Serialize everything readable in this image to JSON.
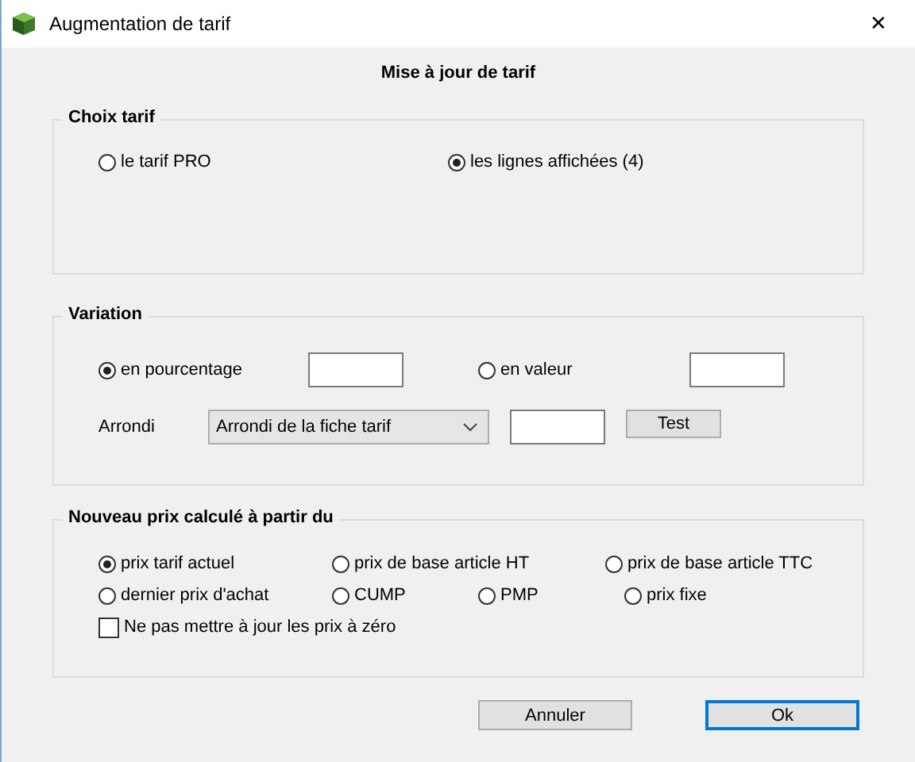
{
  "window": {
    "title": "Augmentation de tarif",
    "close": "✕"
  },
  "heading": "Mise à jour de tarif",
  "choix_tarif": {
    "title": "Choix tarif",
    "options": [
      {
        "label": "le tarif PRO",
        "selected": false
      },
      {
        "label": "les lignes affichées (4)",
        "selected": true
      }
    ]
  },
  "variation": {
    "title": "Variation",
    "options": [
      {
        "label": "en pourcentage",
        "selected": true
      },
      {
        "label": "en valeur",
        "selected": false
      }
    ],
    "arrondi_label": "Arrondi",
    "arrondi_select": "Arrondi de la fiche tarif",
    "test_button": "Test"
  },
  "nouveau_prix": {
    "title": "Nouveau prix calculé à partir du",
    "options": [
      {
        "label": "prix tarif actuel",
        "selected": true
      },
      {
        "label": "prix de base article HT",
        "selected": false
      },
      {
        "label": "prix de base article TTC",
        "selected": false
      },
      {
        "label": "dernier prix d'achat",
        "selected": false
      },
      {
        "label": "CUMP",
        "selected": false
      },
      {
        "label": "PMP",
        "selected": false
      },
      {
        "label": "prix fixe",
        "selected": false
      }
    ],
    "checkbox": {
      "label": "Ne pas mettre à jour les prix à zéro",
      "checked": false
    }
  },
  "buttons": [
    {
      "label": "Annuler",
      "default": false
    },
    {
      "label": "Ok",
      "default": true
    }
  ]
}
